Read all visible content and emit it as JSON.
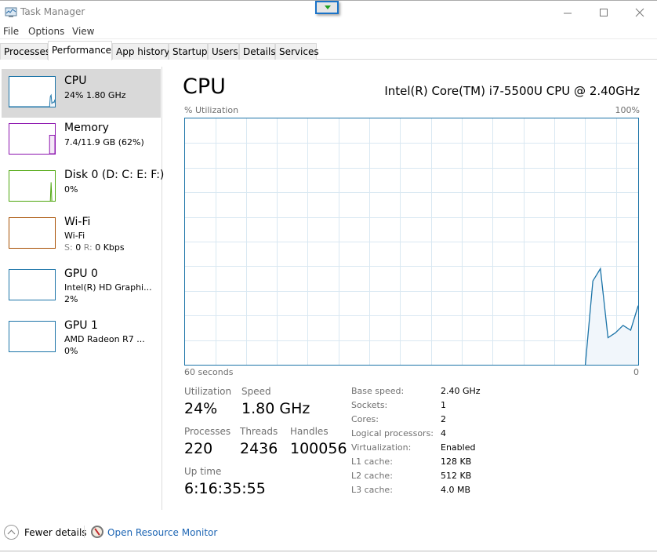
{
  "window": {
    "title": "Task Manager",
    "controls": {
      "minimize": "—",
      "maximize": "☐",
      "close": "✕"
    }
  },
  "menu": [
    "File",
    "Options",
    "View"
  ],
  "tabs": [
    {
      "label": "Processes",
      "active": false
    },
    {
      "label": "Performance",
      "active": true
    },
    {
      "label": "App history",
      "active": false
    },
    {
      "label": "Startup",
      "active": false
    },
    {
      "label": "Users",
      "active": false
    },
    {
      "label": "Details",
      "active": false
    },
    {
      "label": "Services",
      "active": false
    }
  ],
  "sidebar": {
    "items": [
      {
        "title": "CPU",
        "line1": "24% 1.80 GHz",
        "line2": "",
        "color": "#1c74a8",
        "active": true
      },
      {
        "title": "Memory",
        "line1": "7.4/11.9 GB (62%)",
        "line2": "",
        "color": "#8b12ae",
        "active": false
      },
      {
        "title": "Disk 0 (D: C: E: F:)",
        "line1": "0%",
        "line2": "",
        "color": "#4da60c",
        "active": false
      },
      {
        "title": "Wi-Fi",
        "line1": "Wi-Fi",
        "line2_s_label": "S:",
        "line2_s_value": "0",
        "line2_r_label": "R:",
        "line2_r_value": "0 Kbps",
        "color": "#a74f01",
        "active": false
      },
      {
        "title": "GPU 0",
        "line1": "Intel(R) HD Graphi...",
        "line2": "2%",
        "color": "#1c74a8",
        "active": false
      },
      {
        "title": "GPU 1",
        "line1": "AMD Radeon R7 ...",
        "line2": "0%",
        "color": "#1c74a8",
        "active": false
      }
    ]
  },
  "main": {
    "title": "CPU",
    "model": "Intel(R) Core(TM) i7-5500U CPU @ 2.40GHz",
    "util_label": "% Utilization",
    "util_max": "100%",
    "time_label": "60 seconds",
    "time_end": "0",
    "stats": {
      "utilization": {
        "label": "Utilization",
        "value": "24%"
      },
      "speed": {
        "label": "Speed",
        "value": "1.80 GHz"
      },
      "processes": {
        "label": "Processes",
        "value": "220"
      },
      "threads": {
        "label": "Threads",
        "value": "2436"
      },
      "handles": {
        "label": "Handles",
        "value": "100056"
      },
      "uptime": {
        "label": "Up time",
        "value": "6:16:35:55"
      }
    },
    "specs": [
      {
        "label": "Base speed:",
        "value": "2.40 GHz"
      },
      {
        "label": "Sockets:",
        "value": "1"
      },
      {
        "label": "Cores:",
        "value": "2"
      },
      {
        "label": "Logical processors:",
        "value": "4"
      },
      {
        "label": "Virtualization:",
        "value": "Enabled"
      },
      {
        "label": "L1 cache:",
        "value": "128 KB"
      },
      {
        "label": "L2 cache:",
        "value": "512 KB"
      },
      {
        "label": "L3 cache:",
        "value": "4.0 MB"
      }
    ]
  },
  "footer": {
    "fewer_details": "Fewer details",
    "resource_monitor": "Open Resource Monitor"
  },
  "chart_data": {
    "type": "area",
    "title": "CPU % Utilization",
    "xlabel": "60 seconds",
    "ylabel": "% Utilization",
    "xlim": [
      60,
      0
    ],
    "ylim": [
      0,
      100
    ],
    "grid": true,
    "color": "#1c74a8",
    "fill": "#f1f6fb",
    "x_seconds_ago": [
      7,
      6,
      5,
      4,
      3,
      2,
      1,
      0
    ],
    "values": [
      0,
      34,
      39,
      11,
      13,
      16,
      14,
      24
    ],
    "earlier_values": 0
  },
  "thumb_data": {
    "cpu": [
      0,
      0,
      0,
      0,
      0,
      0,
      0,
      0,
      0,
      0,
      0,
      0,
      0,
      0,
      0,
      0,
      0,
      0,
      0,
      0,
      0,
      0,
      0,
      0,
      0,
      0,
      0,
      0,
      0,
      0,
      0,
      0,
      0,
      0,
      0,
      0,
      0,
      0,
      0,
      0,
      0,
      0,
      0,
      0,
      0,
      0,
      0,
      0,
      0,
      0,
      0,
      0,
      0,
      0,
      34,
      39,
      11,
      13,
      16,
      14,
      24
    ],
    "memory_percent": 62,
    "disk_spike_percent": 62
  }
}
